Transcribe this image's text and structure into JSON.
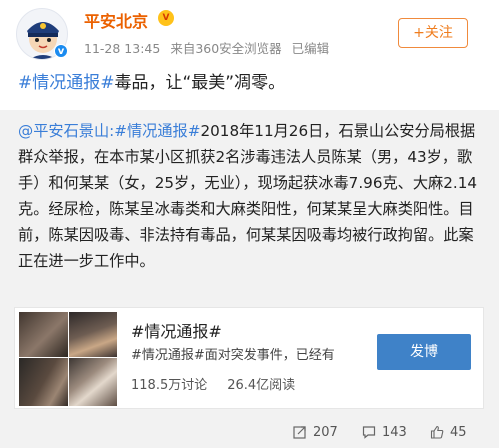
{
  "user": {
    "name": "平安北京",
    "vip_mark": "V",
    "verified_mark": "v",
    "timestamp": "11-28 13:45",
    "source": "来自360安全浏览器",
    "edited": "已编辑"
  },
  "follow_label": "+关注",
  "post": {
    "hashtag": "#情况通报#",
    "text": "毒品，让“最美”凋零。"
  },
  "repost": {
    "author_link": "@平安石景山",
    "hashtag": ":#情况通报#",
    "body": "2018年11月26日，石景山公安分局根据群众举报，在本市某小区抓获2名涉毒违法人员陈某（男，43岁，歌手）和何某某（女，25岁，无业），现场起获冰毒7.96克、大麻2.14克。经尿检，陈某呈冰毒类和大麻类阳性，何某某呈大麻类阳性。目前，陈某因吸毒、非法持有毒品，何某某因吸毒均被行政拘留。此案正在进一步工作中。"
  },
  "topic_card": {
    "title": "#情况通报#",
    "description": "#情况通报#面对突发事件，已经有",
    "reads_count": "118.5万讨论",
    "discussions_count": "26.4亿阅读",
    "post_button": "发博"
  },
  "actions": {
    "repost_count": "207",
    "comment_count": "143",
    "like_count": "45"
  },
  "colors": {
    "username": "#eb6100",
    "link": "#3a7ed8",
    "follow": "#ef7d1e",
    "post_button": "#3f82c8",
    "repost_bg": "#f2f2f2"
  }
}
